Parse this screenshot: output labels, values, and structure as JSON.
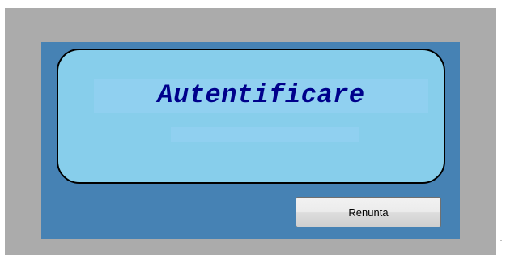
{
  "dialog": {
    "title": "Autentificare",
    "status_text": "",
    "cancel_label": "Renunta"
  },
  "colors": {
    "frame": "#ababab",
    "panel": "#4682b4",
    "title_box": "#87ceeb",
    "title_strip": "#90d0f0",
    "title_text": "#00008b"
  }
}
